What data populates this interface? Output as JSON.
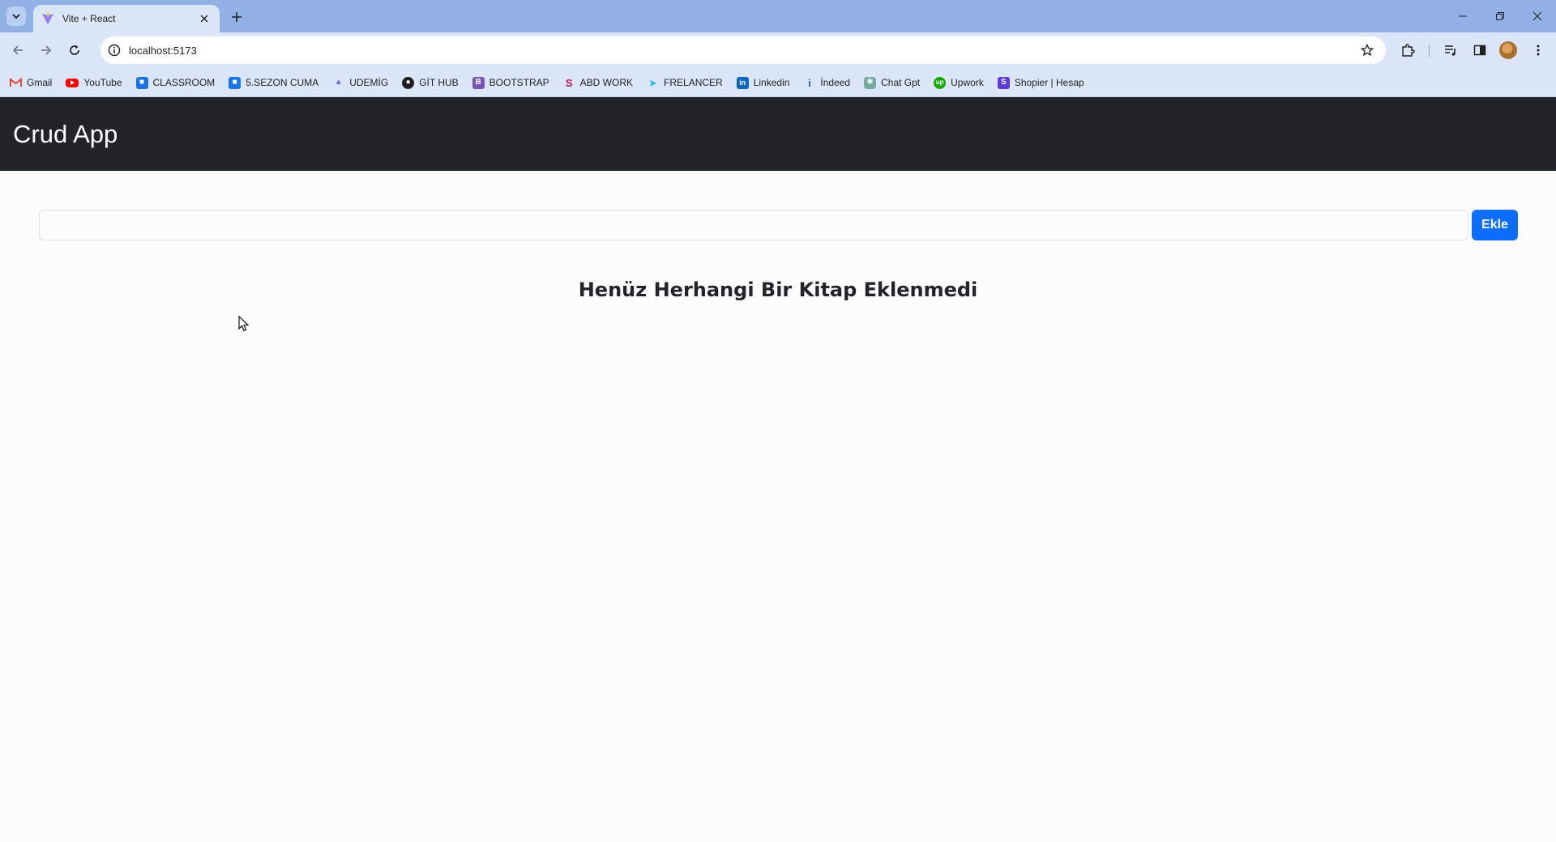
{
  "browser": {
    "tab": {
      "title": "Vite + React"
    },
    "address_bar": {
      "url": "localhost:5173"
    },
    "bookmarks": [
      {
        "label": "Gmail",
        "icon": "gmail-icon",
        "color": "#ea4335"
      },
      {
        "label": "YouTube",
        "icon": "youtube-icon",
        "color": "#ff0000"
      },
      {
        "label": "CLASSROOM",
        "icon": "classroom-icon",
        "color": "#1a73e8"
      },
      {
        "label": "5.SEZON CUMA",
        "icon": "classroom-icon",
        "color": "#1a73e8"
      },
      {
        "label": "UDEMİG",
        "icon": "udemig-icon",
        "color": "#5b6ee1"
      },
      {
        "label": "GİT HUB",
        "icon": "github-icon",
        "color": "#1f1f1f"
      },
      {
        "label": "BOOTSTRAP",
        "icon": "bootstrap-icon",
        "color": "#7952b3"
      },
      {
        "label": "ABD WORK",
        "icon": "sf-icon",
        "color": "#c0154f"
      },
      {
        "label": "FRELANCER",
        "icon": "freelancer-icon",
        "color": "#29b2fe"
      },
      {
        "label": "Linkedin",
        "icon": "linkedin-icon",
        "color": "#0a66c2"
      },
      {
        "label": "İndeed",
        "icon": "indeed-icon",
        "color": "#2557a7"
      },
      {
        "label": "Chat Gpt",
        "icon": "chatgpt-icon",
        "color": "#74aa9c"
      },
      {
        "label": "Upwork",
        "icon": "upwork-icon",
        "color": "#14a800"
      },
      {
        "label": "Shopier | Hesap",
        "icon": "shopier-icon",
        "color": "#5a3bd6"
      }
    ]
  },
  "app": {
    "brand": "Crud App",
    "form": {
      "input_value": "",
      "input_placeholder": "",
      "add_label": "Ekle"
    },
    "empty_message": "Henüz Herhangi Bir Kitap Eklenmedi"
  },
  "colors": {
    "navbar_bg": "#212529",
    "primary": "#0d6efd",
    "tabstrip": "#92b1e6",
    "toolbar": "#dbe6f8"
  }
}
